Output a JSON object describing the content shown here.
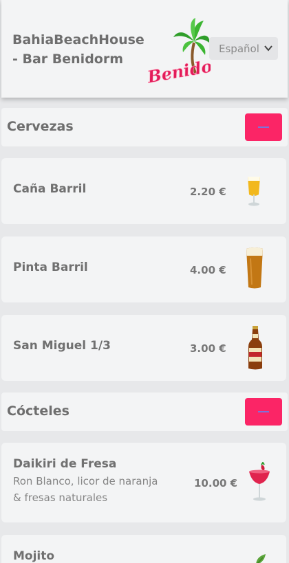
{
  "header": {
    "title": "BahiaBeachHouse - Bar Benidorm",
    "logo_text": "Benidorm",
    "language": "Español"
  },
  "sections": [
    {
      "title": "Cervezas",
      "items": [
        {
          "name": "Caña Barril",
          "price": "2.20 €",
          "icon": "beer-glass-icon"
        },
        {
          "name": "Pinta Barril",
          "price": "4.00 €",
          "icon": "pint-glass-icon"
        },
        {
          "name": "San Miguel 1/3",
          "price": "3.00 €",
          "icon": "beer-bottle-icon"
        }
      ]
    },
    {
      "title": "Cócteles",
      "items": [
        {
          "name": "Daikiri de Fresa",
          "description": "Ron Blanco, licor de naranja & fresas naturales",
          "price": "10.00 €",
          "icon": "strawberry-cocktail-icon"
        },
        {
          "name": "Mojito",
          "icon": "mojito-icon"
        }
      ]
    }
  ],
  "colors": {
    "accent": "#fb2566",
    "card": "#f3f4f5",
    "background": "#e7e8ea"
  }
}
